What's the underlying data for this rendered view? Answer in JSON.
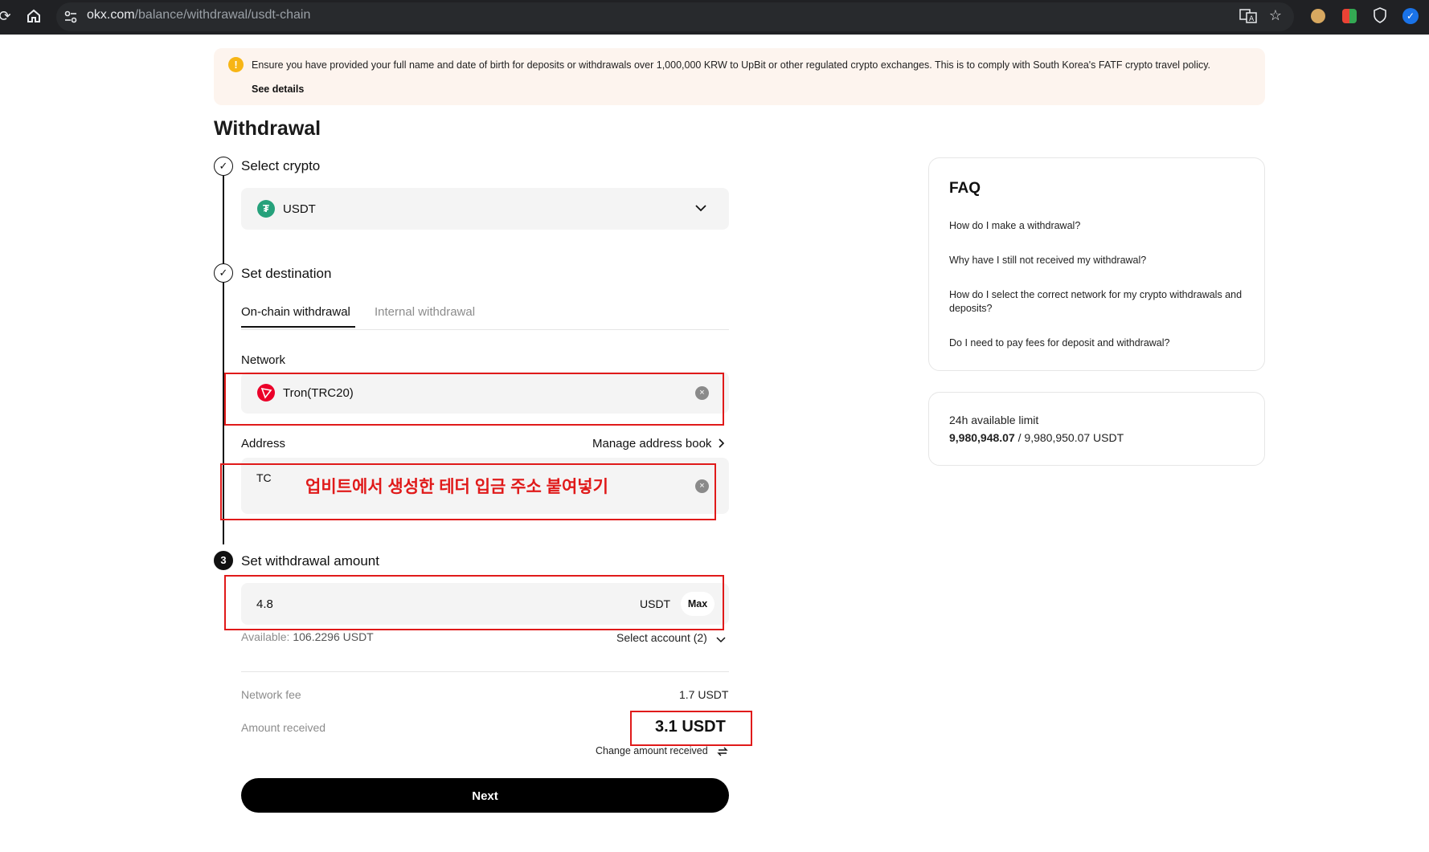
{
  "browser": {
    "url_domain": "okx.com",
    "url_path": "/balance/withdrawal/usdt-chain",
    "reload_icon": "reload-icon",
    "home_icon": "home-icon"
  },
  "notice": {
    "icon": "!",
    "text": "Ensure you have provided your full name and date of birth for deposits or withdrawals over 1,000,000 KRW to UpBit or other regulated crypto exchanges. This is to comply with South Korea's FATF crypto travel policy.",
    "link": "See details"
  },
  "page": {
    "title": "Withdrawal"
  },
  "steps": {
    "select_crypto": {
      "title": "Select crypto",
      "coin_symbol": "₮",
      "coin": "USDT"
    },
    "set_destination": {
      "title": "Set destination",
      "tabs": [
        "On-chain withdrawal",
        "Internal withdrawal"
      ],
      "network_label": "Network",
      "network_value": "Tron(TRC20)",
      "address_label": "Address",
      "address_book": "Manage address book",
      "address_value": "TC",
      "annotation": "업비트에서 생성한 테더 입금 주소 붙여넣기"
    },
    "set_amount": {
      "number": "3",
      "title": "Set withdrawal amount",
      "amount": "4.8",
      "unit": "USDT",
      "max": "Max",
      "available_label": "Available:",
      "available_value": "106.2296 USDT",
      "select_account": "Select account (2)"
    }
  },
  "summary": {
    "fee_label": "Network fee",
    "fee_value": "1.7 USDT",
    "received_label": "Amount received",
    "received_value": "3.1 USDT",
    "change_label": "Change amount received"
  },
  "next_button": "Next",
  "faq": {
    "title": "FAQ",
    "items": [
      "How do I make a withdrawal?",
      "Why have I still not received my withdrawal?",
      "How do I select the correct network for my crypto withdrawals and deposits?",
      "Do I need to pay fees for deposit and withdrawal?"
    ]
  },
  "limit": {
    "label": "24h available limit",
    "available": "9,980,948.07",
    "separator": "/",
    "total": "9,980,950.07 USDT"
  },
  "colors": {
    "annotation_red": "#e01a1a",
    "usdt_green": "#26a17b",
    "tron_red": "#eb0029"
  }
}
